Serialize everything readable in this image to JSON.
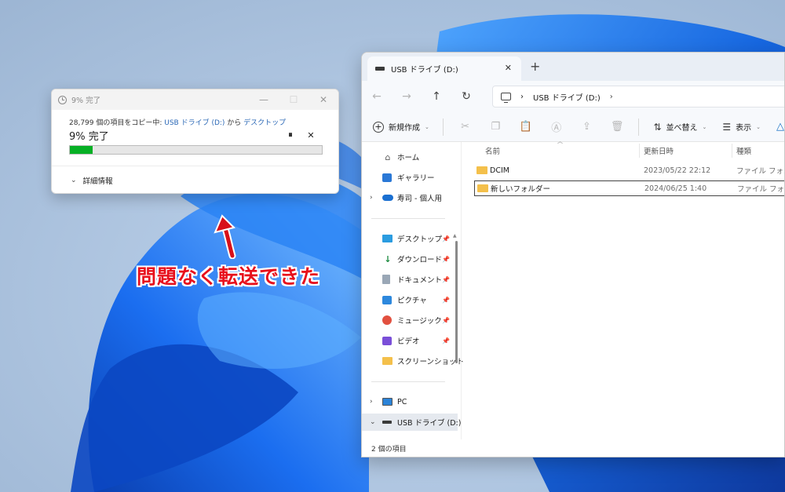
{
  "copy_dialog": {
    "title": "9% 完了",
    "minimize": "—",
    "maximize": "☐",
    "close": "✕",
    "status_prefix": "28,799 個の項目をコピー中: ",
    "source": "USB ドライブ (D:)",
    "middle": " から ",
    "destination": "デスクトップ",
    "percent_text": "9% 完了",
    "pause_label": "⏸",
    "cancel_label": "✕",
    "progress": 0.09,
    "more_details": "詳細情報",
    "progress_color": "#06b025"
  },
  "annotation": {
    "text": "問題なく転送できた",
    "color": "#e8101c"
  },
  "explorer": {
    "tab_title": "USB ドライブ (D:)",
    "tab_close": "✕",
    "new_tab": "+",
    "nav": {
      "back": "←",
      "forward": "→",
      "up": "↑",
      "refresh": "↻"
    },
    "breadcrumb": {
      "location": "USB ドライブ (D:)",
      "sep": "›"
    },
    "toolbar": {
      "new_label": "新規作成",
      "sort_label": "並べ替え",
      "view_label": "表示",
      "dropdown": "⌄"
    },
    "sidebar": [
      {
        "label": "ホーム",
        "icon": "home-icon",
        "glyph": "⌂"
      },
      {
        "label": "ギャラリー",
        "icon": "gallery-icon"
      },
      {
        "label": "寿司 - 個人用",
        "icon": "onedrive-icon"
      },
      {
        "label": "デスクトップ",
        "icon": "desktop-icon",
        "pinned": true
      },
      {
        "label": "ダウンロード",
        "icon": "download-icon",
        "glyph": "↓",
        "pinned": true
      },
      {
        "label": "ドキュメント",
        "icon": "document-icon",
        "pinned": true
      },
      {
        "label": "ピクチャ",
        "icon": "pictures-icon",
        "pinned": true
      },
      {
        "label": "ミュージック",
        "icon": "music-icon",
        "pinned": true
      },
      {
        "label": "ビデオ",
        "icon": "video-icon",
        "pinned": true
      },
      {
        "label": "スクリーンショット",
        "icon": "folder-icon"
      },
      {
        "label": "PC",
        "icon": "pc-icon"
      },
      {
        "label": "USB ドライブ (D:)",
        "icon": "usb-drive-icon"
      }
    ],
    "pin_glyph": "📌",
    "chevron_right": "›",
    "chevron_down": "⌄",
    "columns": {
      "name": "名前",
      "date": "更新日時",
      "type": "種類"
    },
    "files": [
      {
        "name": "DCIM",
        "date": "2023/05/22 22:12",
        "type": "ファイル フォルダー"
      },
      {
        "name": "新しいフォルダー",
        "date": "2024/06/25 1:40",
        "type": "ファイル フォルダー"
      }
    ],
    "status": "2 個の項目"
  }
}
